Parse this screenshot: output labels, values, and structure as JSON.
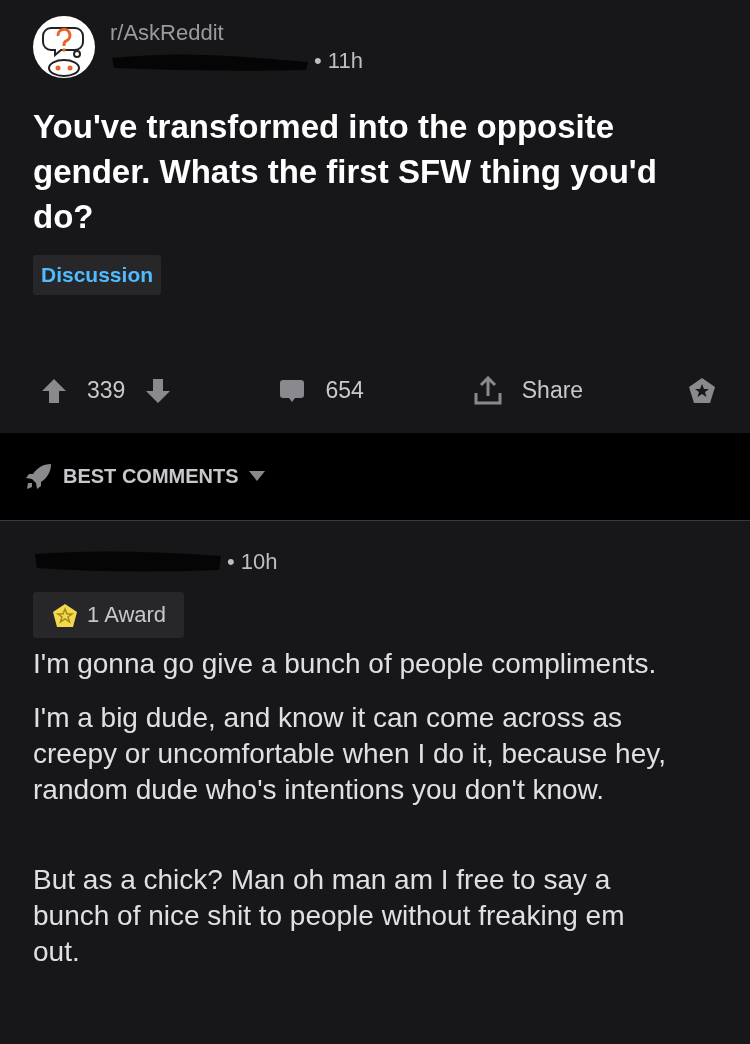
{
  "post": {
    "subreddit": "r/AskReddit",
    "time": "• 11h",
    "title": "You've transformed into the opposite gender. Whats the first SFW thing you'd do?",
    "flair": "Discussion",
    "score": "339",
    "comments": "654",
    "share": "Share"
  },
  "sort": {
    "label": "BEST COMMENTS"
  },
  "comment": {
    "time": "• 10h",
    "award": "1 Award",
    "paragraphs": [
      "I'm gonna go give a bunch of people compliments.",
      "I'm a big dude, and know it can come across as creepy or uncomfortable when I do it, because hey, random dude who's intentions you don't know.",
      "But as a chick? Man oh man am I free to say a bunch of nice shit to people without freaking em out."
    ]
  }
}
